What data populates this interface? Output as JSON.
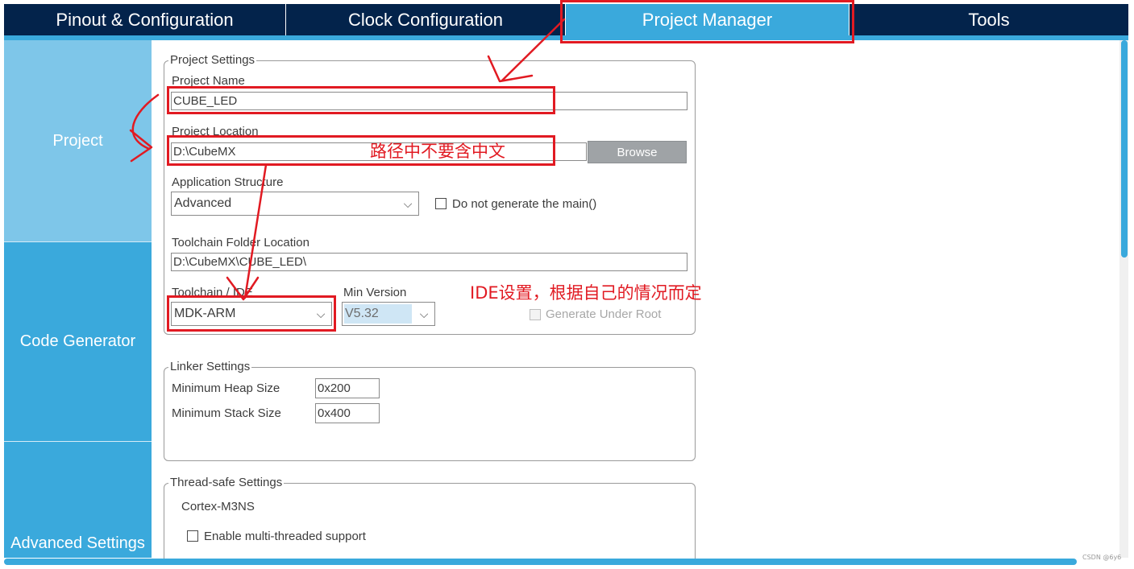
{
  "tabs": [
    {
      "label": "Pinout & Configuration",
      "active": false
    },
    {
      "label": "Clock Configuration",
      "active": false
    },
    {
      "label": "Project Manager",
      "active": true
    },
    {
      "label": "Tools",
      "active": false
    }
  ],
  "sidebar": {
    "items": [
      {
        "label": "Project",
        "active": true
      },
      {
        "label": "Code Generator",
        "active": false
      },
      {
        "label": "Advanced Settings",
        "active": false
      }
    ]
  },
  "project_settings": {
    "legend": "Project Settings",
    "project_name_label": "Project Name",
    "project_name_value": "CUBE_LED",
    "project_location_label": "Project Location",
    "project_location_value": "D:\\CubeMX",
    "browse_label": "Browse",
    "app_structure_label": "Application Structure",
    "app_structure_value": "Advanced",
    "no_main_label": "Do not generate the main()",
    "no_main_checked": false,
    "toolchain_folder_label": "Toolchain Folder Location",
    "toolchain_folder_value": "D:\\CubeMX\\CUBE_LED\\",
    "toolchain_ide_label": "Toolchain / IDE",
    "toolchain_ide_value": "MDK-ARM",
    "min_version_label": "Min Version",
    "min_version_value": "V5.32",
    "generate_under_root_label": "Generate Under Root",
    "generate_under_root_checked": false
  },
  "linker_settings": {
    "legend": "Linker Settings",
    "heap_label": "Minimum Heap Size",
    "heap_value": "0x200",
    "stack_label": "Minimum Stack Size",
    "stack_value": "0x400"
  },
  "thread_safe_settings": {
    "legend": "Thread-safe Settings",
    "core": "Cortex-M3NS",
    "multithread_label": "Enable multi-threaded support",
    "multithread_checked": false
  },
  "annotations": {
    "path_note": "路径中不要含中文",
    "ide_note": "IDE设置，根据自己的情况而定"
  },
  "watermark": "CSDN @6y6",
  "colors": {
    "tab_bar": "#03234b",
    "accent": "#3aa9dc",
    "sidebar_active": "#7ec6e9",
    "annotation_red": "#e11a22"
  }
}
